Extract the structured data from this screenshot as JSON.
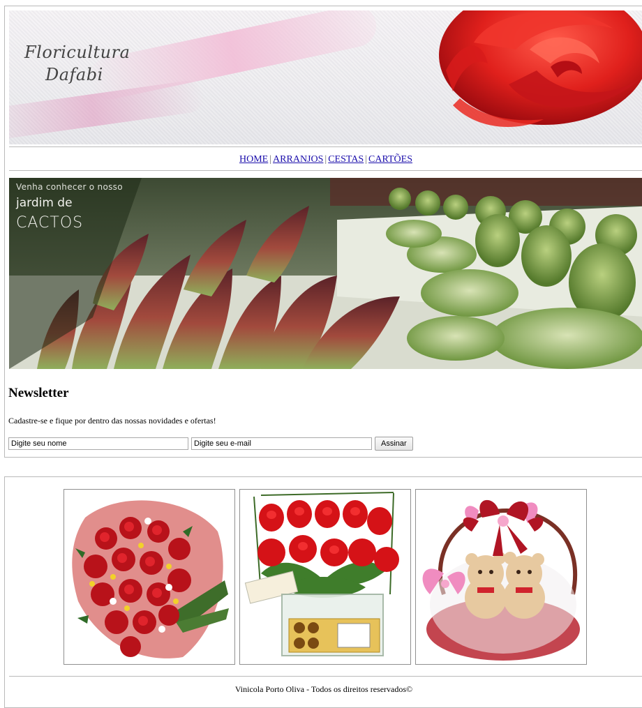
{
  "header": {
    "logo_line1": "Floricultura",
    "logo_line2": "Dafabi"
  },
  "nav": {
    "items": [
      {
        "label": "HOME"
      },
      {
        "label": "ARRANJOS"
      },
      {
        "label": "CESTAS"
      },
      {
        "label": "CARTÕES"
      }
    ],
    "separator": "|"
  },
  "promo": {
    "line1": "Venha conhecer o nosso",
    "line2": "jardim de",
    "line3": "CACTOS"
  },
  "newsletter": {
    "title": "Newsletter",
    "text": "Cadastre-se e fique por dentro das nossas novidades e ofertas!",
    "name_value": "Digite seu nome",
    "email_value": "Digite seu e-mail",
    "submit_label": "Assinar"
  },
  "products": [
    {
      "icon": "rose-bouquet-image"
    },
    {
      "icon": "roses-chocolate-box-image"
    },
    {
      "icon": "teddy-bear-basket-image"
    }
  ],
  "footer": {
    "text": "Vinicola Porto Oliva - Todos os direitos reservados©"
  }
}
